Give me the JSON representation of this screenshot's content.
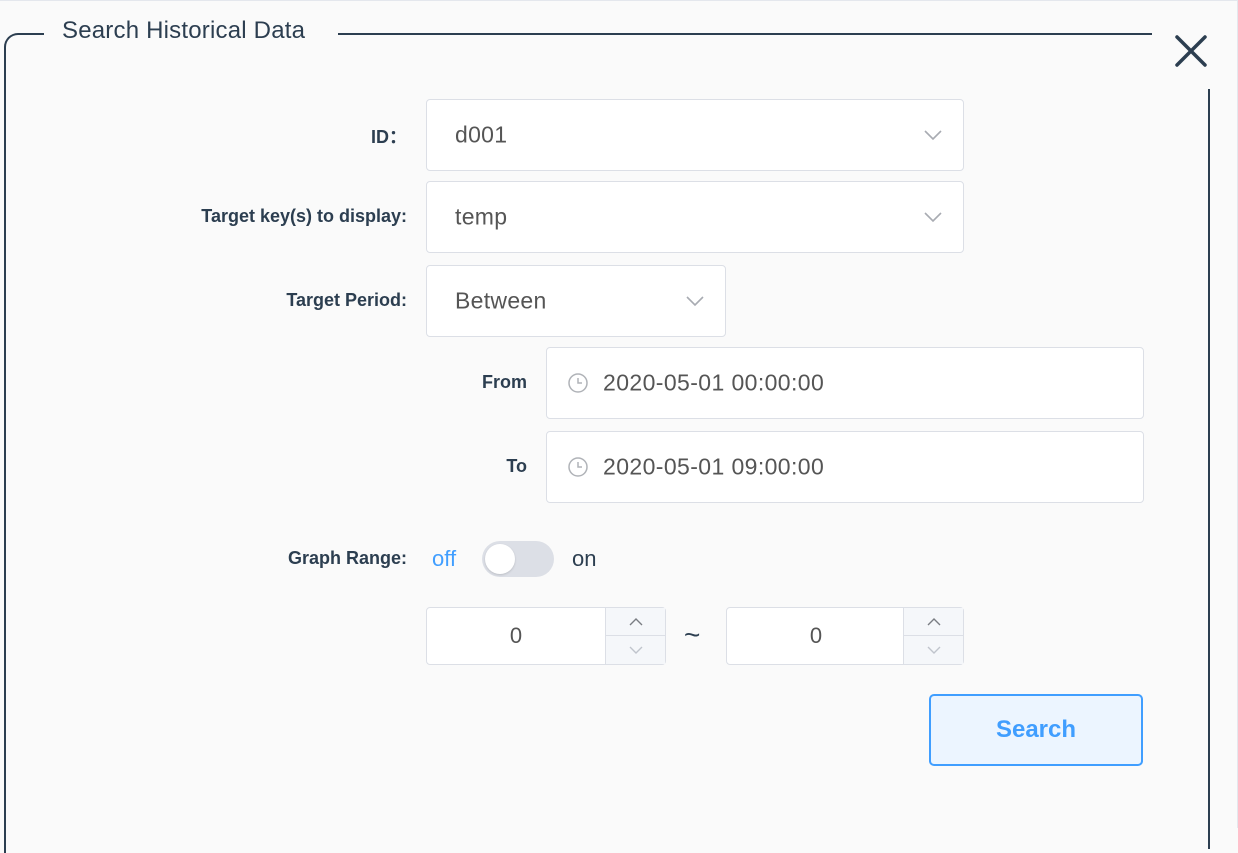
{
  "dialog": {
    "title": "Search Historical Data"
  },
  "form": {
    "id": {
      "label": "ID：",
      "value": "d001"
    },
    "target_keys": {
      "label": "Target key(s) to display:",
      "value": "temp"
    },
    "target_period": {
      "label": "Target Period:",
      "value": "Between"
    },
    "from": {
      "label": "From",
      "value": "2020-05-01 00:00:00"
    },
    "to": {
      "label": "To",
      "value": "2020-05-01 09:00:00"
    },
    "graph_range": {
      "label": "Graph Range:",
      "off_label": "off",
      "on_label": "on",
      "enabled": false,
      "min": "0",
      "max": "0",
      "separator": "~"
    },
    "search_label": "Search"
  },
  "colors": {
    "accent": "#409eff",
    "text": "#2c3e50",
    "border": "#dcdfe6"
  },
  "icons": {
    "close": "close-icon",
    "chevron": "chevron-down-icon",
    "clock": "clock-icon",
    "up": "chevron-up-icon",
    "down": "chevron-down-icon"
  }
}
